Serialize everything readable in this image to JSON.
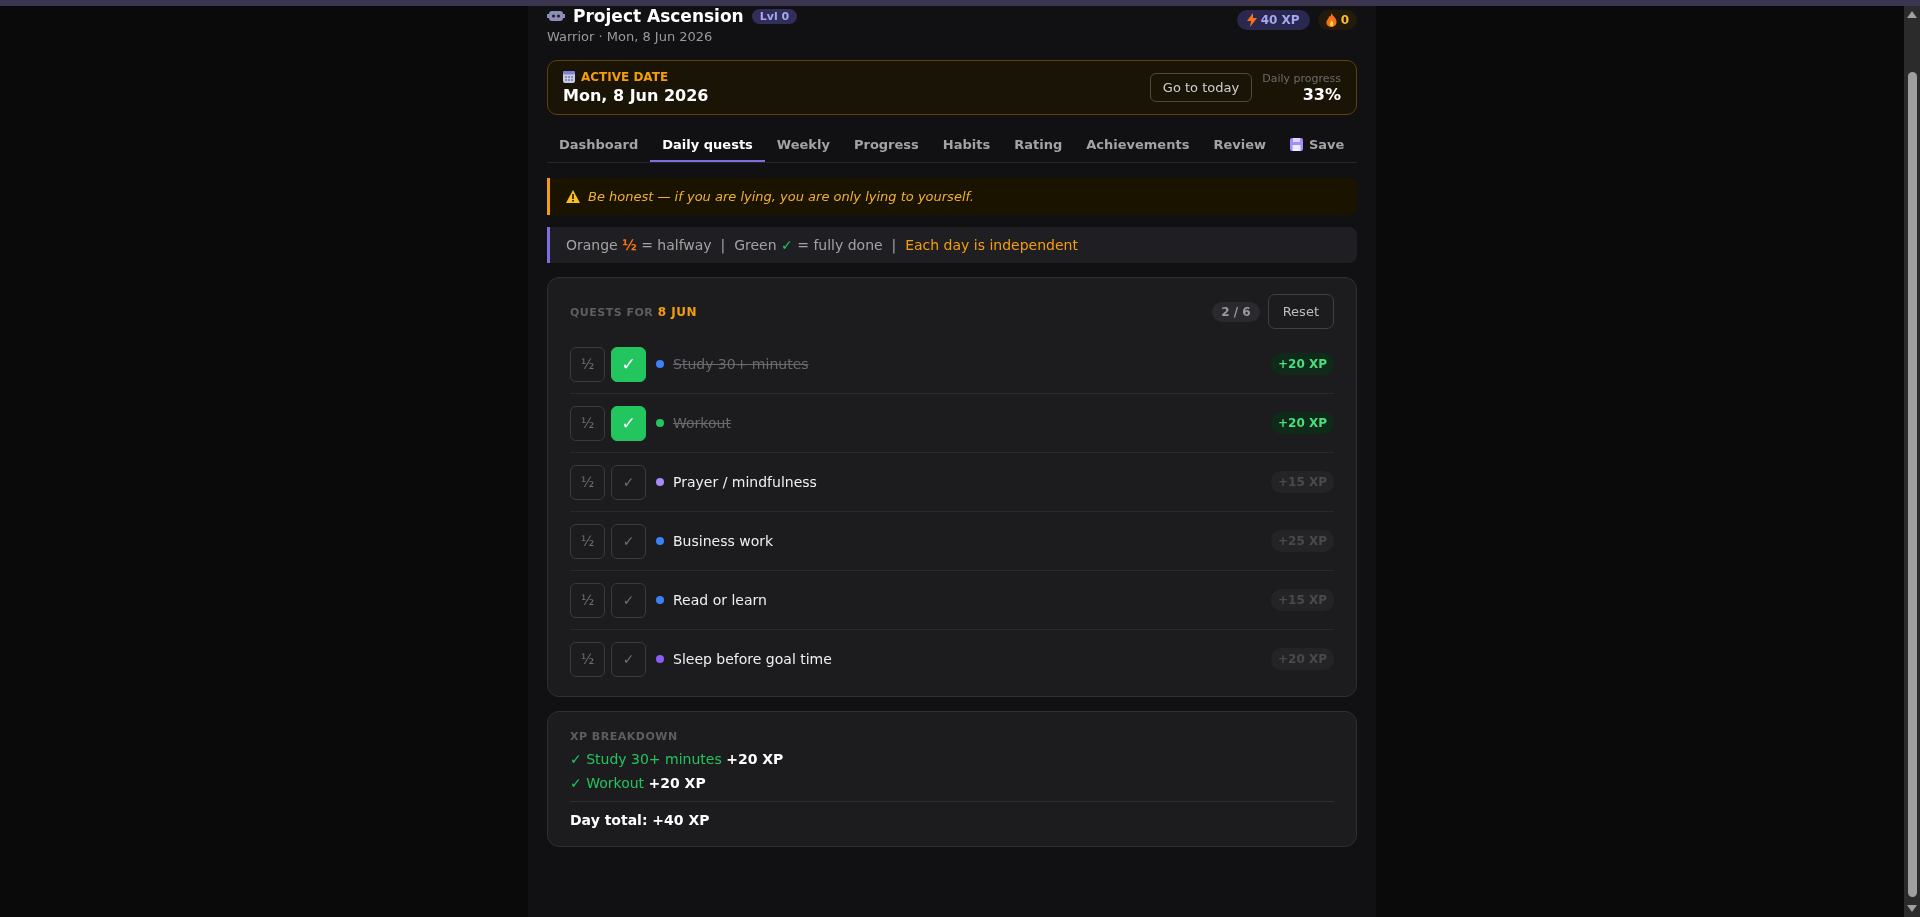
{
  "header": {
    "title": "Project Ascension",
    "level_badge": "Lvl 0",
    "subtitle": "Warrior · Mon, 8 Jun 2026",
    "xp_badge": "40 XP",
    "streak_badge": "0"
  },
  "active_date": {
    "label": "ACTIVE DATE",
    "date": "Mon, 8 Jun 2026",
    "button": "Go to today",
    "progress_label": "Daily progress",
    "progress_value": "33%"
  },
  "tabs": [
    {
      "label": "Dashboard",
      "selected": false
    },
    {
      "label": "Daily quests",
      "selected": true
    },
    {
      "label": "Weekly",
      "selected": false
    },
    {
      "label": "Progress",
      "selected": false
    },
    {
      "label": "Habits",
      "selected": false
    },
    {
      "label": "Rating",
      "selected": false
    },
    {
      "label": "Achievements",
      "selected": false
    },
    {
      "label": "Review",
      "selected": false
    },
    {
      "label": "Save",
      "selected": false,
      "kind": "save"
    }
  ],
  "warning": "Be honest — if you are lying, you are only lying to yourself.",
  "legend": [
    {
      "text": "Orange ",
      "kind": "plain"
    },
    {
      "text": "½",
      "kind": "half"
    },
    {
      "text": " = halfway  |  Green ",
      "kind": "plain"
    },
    {
      "text": "✓",
      "kind": "check"
    },
    {
      "text": " = fully done  |  ",
      "kind": "plain"
    },
    {
      "text": "Each day is independent",
      "kind": "accent"
    }
  ],
  "quests": {
    "heading": "QUESTS FOR ",
    "heading_date": "8 JUN",
    "count": "2 / 6",
    "reset": "Reset",
    "items": [
      {
        "half": "½",
        "check": "✓",
        "name": "Study 30+ minutes",
        "xp": "+20 XP",
        "half_done": false,
        "done": true,
        "color": "#3b82f6"
      },
      {
        "half": "½",
        "check": "✓",
        "name": "Workout",
        "xp": "+20 XP",
        "half_done": false,
        "done": true,
        "color": "#22c55e"
      },
      {
        "half": "½",
        "check": "✓",
        "name": "Prayer / mindfulness",
        "xp": "+15 XP",
        "half_done": false,
        "done": false,
        "color": "#a78bfa"
      },
      {
        "half": "½",
        "check": "✓",
        "name": "Business work",
        "xp": "+25 XP",
        "half_done": false,
        "done": false,
        "color": "#3b82f6"
      },
      {
        "half": "½",
        "check": "✓",
        "name": "Read or learn",
        "xp": "+15 XP",
        "half_done": false,
        "done": false,
        "color": "#3b82f6"
      },
      {
        "half": "½",
        "check": "✓",
        "name": "Sleep before goal time",
        "xp": "+20 XP",
        "half_done": false,
        "done": false,
        "color": "#8b5cf6"
      }
    ]
  },
  "breakdown": {
    "heading": "XP BREAKDOWN",
    "lines": [
      {
        "name": "✓ Study 30+ minutes",
        "xp": "+20 XP"
      },
      {
        "name": "✓ Workout",
        "xp": "+20 XP"
      }
    ],
    "total": "Day total: +40 XP"
  }
}
